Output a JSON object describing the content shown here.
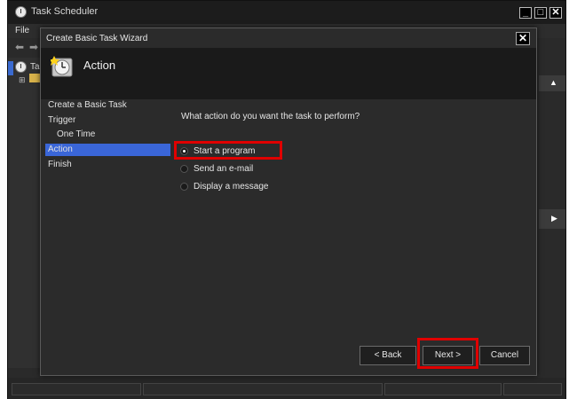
{
  "main_window": {
    "title": "Task Scheduler",
    "menu": [
      "File"
    ],
    "tree_label": "Ta",
    "minimize_glyph": "_",
    "maximize_glyph": "□",
    "close_glyph": "✕",
    "right_arrow_up": "▲",
    "right_arrow_right": "▶"
  },
  "dialog": {
    "title": "Create Basic Task Wizard",
    "close_glyph": "✕",
    "heading": "Action",
    "nav_items": [
      {
        "label": "Create a Basic Task"
      },
      {
        "label": "Trigger"
      },
      {
        "label": "One Time"
      },
      {
        "label": "Action"
      },
      {
        "label": "Finish"
      }
    ],
    "question": "What action do you want the task to perform?",
    "options": [
      {
        "label": "Start a program",
        "checked": true
      },
      {
        "label": "Send an e-mail",
        "checked": false
      },
      {
        "label": "Display a message",
        "checked": false
      }
    ],
    "buttons": {
      "back": "< Back",
      "next": "Next >",
      "cancel": "Cancel"
    }
  },
  "colors": {
    "accent_selection": "#3a66d8",
    "highlight_box": "#e00000",
    "dialog_bg": "#2b2b2b",
    "header_bg": "#1a1a1a"
  }
}
